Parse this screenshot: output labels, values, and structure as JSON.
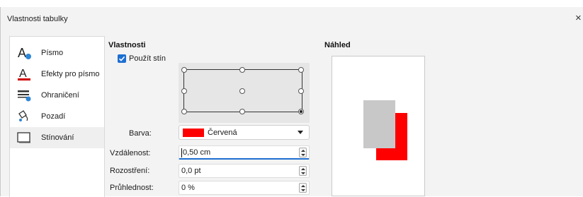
{
  "window": {
    "title": "Vlastnosti tabulky",
    "close_glyph": "×"
  },
  "sidebar": {
    "items": [
      {
        "label": "Písmo",
        "icon": "font-icon"
      },
      {
        "label": "Efekty pro písmo",
        "icon": "font-effects-icon"
      },
      {
        "label": "Ohraničení",
        "icon": "borders-icon"
      },
      {
        "label": "Pozadí",
        "icon": "background-icon"
      },
      {
        "label": "Stínování",
        "icon": "shadow-icon",
        "selected": true
      }
    ]
  },
  "properties": {
    "heading": "Vlastnosti",
    "use_shadow": {
      "label": "Použít stín",
      "checked": true
    },
    "position": {
      "selected": "bottom-right"
    },
    "color": {
      "label": "Barva:",
      "value": "Červená",
      "swatch": "#ff0000"
    },
    "distance": {
      "label": "Vzdálenost:",
      "value": "0,50 cm"
    },
    "blur": {
      "label": "Rozostření:",
      "value": "0,0 pt"
    },
    "transparency": {
      "label": "Průhlednost:",
      "value": "0 %"
    }
  },
  "preview": {
    "heading": "Náhled",
    "colors": {
      "shadow": "#ff0000",
      "object": "#c8c8c8"
    }
  },
  "colors": {
    "accent": "#1e6fd1"
  }
}
